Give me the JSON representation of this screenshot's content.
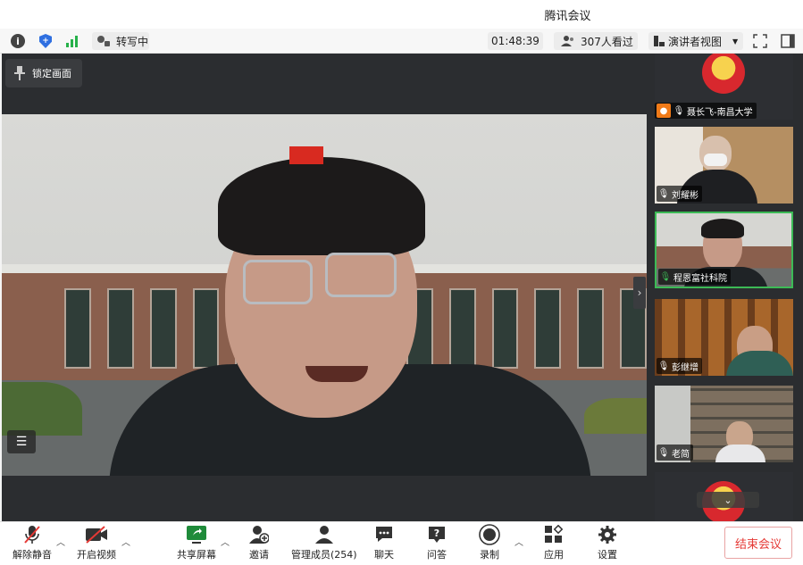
{
  "window": {
    "title": "腾讯会议"
  },
  "infobar": {
    "transcribe_label": "转写中",
    "timer": "01:48:39",
    "viewers": "307人看过",
    "view_mode": "演讲者视图"
  },
  "main": {
    "lock_label": "锁定画面"
  },
  "sidebar": {
    "participants": [
      {
        "name": "聂长飞-南昌大学",
        "mic": "off"
      },
      {
        "name": "刘耀彬",
        "mic": "off"
      },
      {
        "name": "程恩富社科院",
        "mic": "on"
      },
      {
        "name": "彭继增",
        "mic": "off"
      },
      {
        "name": "老简",
        "mic": "off"
      }
    ],
    "more_icon": "chevron-down-icon"
  },
  "toolbar": {
    "unmute": "解除静音",
    "start_video": "开启视频",
    "share_screen": "共享屏幕",
    "invite": "邀请",
    "manage_members": "管理成员(254)",
    "chat": "聊天",
    "qa": "问答",
    "record": "录制",
    "apps": "应用",
    "settings": "设置",
    "end_meeting": "结束会议"
  },
  "colors": {
    "accent_green": "#3cba56",
    "end_red": "#e53935",
    "shield_blue": "#2f6fe0"
  }
}
